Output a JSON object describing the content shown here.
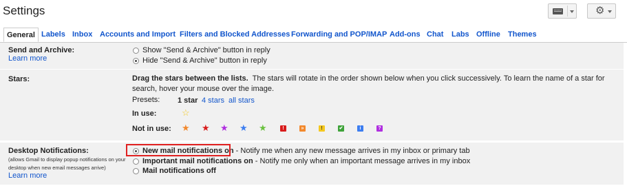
{
  "page": {
    "title": "Settings"
  },
  "toolbar": {
    "keyboard_icon": "keyboard-icon",
    "gear_icon": "gear-icon"
  },
  "tabs": [
    {
      "label": "General",
      "active": true
    },
    {
      "label": "Labels"
    },
    {
      "label": "Inbox"
    },
    {
      "label": "Accounts and Import"
    },
    {
      "label": "Filters and Blocked Addresses"
    },
    {
      "label": "Forwarding and POP/IMAP"
    },
    {
      "label": "Add-ons"
    },
    {
      "label": "Chat"
    },
    {
      "label": "Labs"
    },
    {
      "label": "Offline"
    },
    {
      "label": "Themes"
    }
  ],
  "send_archive": {
    "label": "Send and Archive:",
    "learn_more": "Learn more",
    "option_show": "Show \"Send & Archive\" button in reply",
    "option_hide": "Hide \"Send & Archive\" button in reply",
    "selected": "hide"
  },
  "stars": {
    "label": "Stars:",
    "instruction_bold": "Drag the stars between the lists.",
    "instruction": "The stars will rotate in the order shown below when you click successively. To learn the name of a star for search, hover your mouse over the image.",
    "presets_label": "Presets:",
    "preset_1": "1 star",
    "preset_4": "4 stars",
    "preset_all": "all stars",
    "in_use_label": "In use:",
    "not_in_use_label": "Not in use:",
    "box_symbols": {
      "red_bang": "!",
      "orange_guillemet": "»",
      "yellow_bang": "!",
      "green_check": "✔",
      "blue_info": "i",
      "purple_question": "?"
    },
    "colors": {
      "yellow": "#f4c81f",
      "orange": "#f2892d",
      "red": "#d81c1c",
      "purple": "#b02fe0",
      "blue": "#3d7ef0",
      "green": "#6ac13f"
    }
  },
  "desktop": {
    "label": "Desktop Notifications:",
    "note": "(allows Gmail to display popup notifications on your desktop when new email messages arrive)",
    "learn_more": "Learn more",
    "opt1_bold": "New mail notifications on",
    "opt1_rest": " - Notify me when any new message arrives in my inbox or primary tab",
    "opt2_bold": "Important mail notifications on",
    "opt2_rest": " - Notify me only when an important message arrives in my inbox",
    "opt3_bold": "Mail notifications off",
    "selected": "new"
  }
}
